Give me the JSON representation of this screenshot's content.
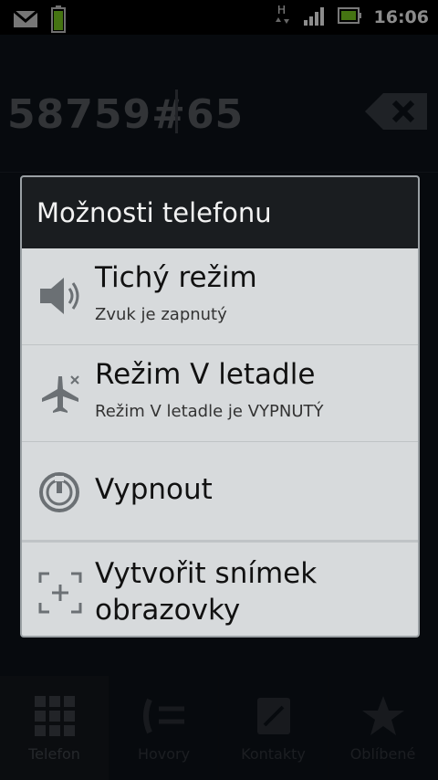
{
  "status_bar": {
    "left_icons": [
      "gmail-icon",
      "battery-charging-icon"
    ],
    "right_icons": [
      "hspa-data-icon",
      "signal-icon",
      "battery-icon"
    ],
    "time": "16:06"
  },
  "dialer": {
    "number": "58759#65",
    "tabs": [
      {
        "label": "Telefon",
        "icon": "dialpad-icon",
        "active": true
      },
      {
        "label": "Hovory",
        "icon": "call-log-icon",
        "active": false
      },
      {
        "label": "Kontakty",
        "icon": "contacts-icon",
        "active": false
      },
      {
        "label": "Oblíbené",
        "icon": "star-icon",
        "active": false
      }
    ]
  },
  "dialog": {
    "title": "Možnosti telefonu",
    "options": [
      {
        "title": "Tichý režim",
        "subtitle": "Zvuk je zapnutý",
        "icon": "speaker-icon"
      },
      {
        "title": "Režim V letadle",
        "subtitle": "Režim V letadle je VYPNUTÝ",
        "icon": "airplane-icon"
      },
      {
        "title": "Vypnout",
        "icon": "power-icon"
      },
      {
        "title_line1": "Vytvořit snímek",
        "title_line2": "obrazovky",
        "icon": "screenshot-icon"
      }
    ]
  },
  "colors": {
    "dialog_bg": "#d7dadc",
    "title_bg": "#1a1d20",
    "battery_green": "#7ed321"
  }
}
